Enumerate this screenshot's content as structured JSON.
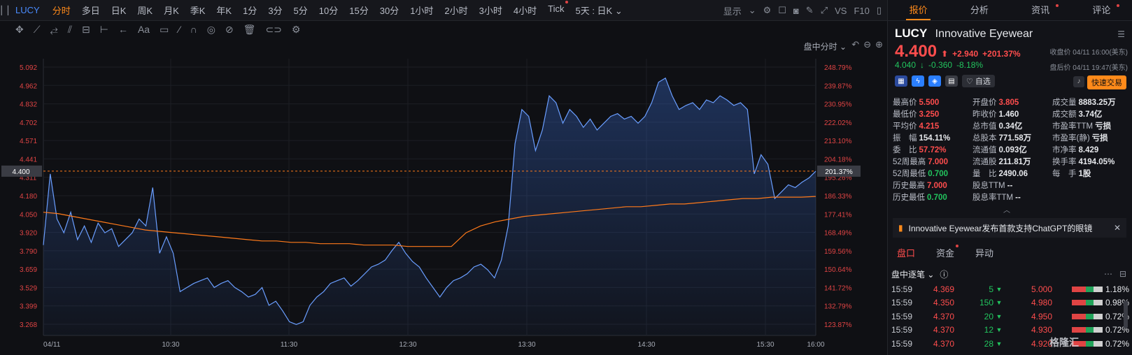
{
  "toolbar": {
    "symbol": "LUCY",
    "periods": [
      {
        "label": "分时",
        "active": true,
        "dot": false
      },
      {
        "label": "多日",
        "active": false,
        "dot": false
      },
      {
        "label": "日K",
        "active": false,
        "dot": false
      },
      {
        "label": "周K",
        "active": false,
        "dot": false
      },
      {
        "label": "月K",
        "active": false,
        "dot": false
      },
      {
        "label": "季K",
        "active": false,
        "dot": false
      },
      {
        "label": "年K",
        "active": false,
        "dot": false
      },
      {
        "label": "1分",
        "active": false,
        "dot": false
      },
      {
        "label": "3分",
        "active": false,
        "dot": false
      },
      {
        "label": "5分",
        "active": false,
        "dot": false
      },
      {
        "label": "10分",
        "active": false,
        "dot": false
      },
      {
        "label": "15分",
        "active": false,
        "dot": false
      },
      {
        "label": "30分",
        "active": false,
        "dot": false
      },
      {
        "label": "1小时",
        "active": false,
        "dot": false
      },
      {
        "label": "2小时",
        "active": false,
        "dot": false
      },
      {
        "label": "3小时",
        "active": false,
        "dot": false
      },
      {
        "label": "4小时",
        "active": false,
        "dot": false
      },
      {
        "label": "Tick",
        "active": false,
        "dot": true
      },
      {
        "label": "5天 : 日K ⌄",
        "active": false,
        "dot": false
      }
    ],
    "display_label": "显示",
    "vs_label": "VS",
    "f10_label": "F10"
  },
  "chart_mode_label": "盘中分时 ⌄",
  "chart_data": {
    "type": "line",
    "x_ticks": [
      "04/11",
      "10:30",
      "11:30",
      "12:30",
      "13:30",
      "14:30",
      "15:30",
      "16:00"
    ],
    "y_ticks_left": [
      "5.092",
      "4.962",
      "4.832",
      "4.702",
      "4.571",
      "4.441",
      "4.311",
      "4.180",
      "4.050",
      "3.920",
      "3.790",
      "3.659",
      "3.529",
      "3.399",
      "3.268"
    ],
    "y_ticks_right": [
      "248.79%",
      "239.87%",
      "230.95%",
      "222.02%",
      "213.10%",
      "204.18%",
      "195.26%",
      "186.33%",
      "177.41%",
      "168.49%",
      "159.56%",
      "150.64%",
      "141.72%",
      "132.79%",
      "123.87%"
    ],
    "ylim": [
      3.2,
      5.16
    ],
    "current_price": 4.4,
    "current_price_label": "4.400",
    "current_pct_label": "201.37%",
    "series": [
      {
        "values": [
          3.86,
          4.38,
          4.05,
          3.95,
          4.1,
          3.9,
          4.0,
          3.88,
          4.02,
          3.95,
          3.98,
          3.85,
          3.9,
          3.95,
          4.05,
          4.0,
          4.28,
          3.8,
          3.92,
          3.8,
          3.52,
          3.55,
          3.58,
          3.6,
          3.62,
          3.55,
          3.58,
          3.6,
          3.55,
          3.52,
          3.48,
          3.5,
          3.55,
          3.42,
          3.45,
          3.38,
          3.3,
          3.28,
          3.3,
          3.42,
          3.48,
          3.52,
          3.58,
          3.6,
          3.62,
          3.56,
          3.6,
          3.65,
          3.7,
          3.72,
          3.75,
          3.82,
          3.88,
          3.8,
          3.74,
          3.7,
          3.62,
          3.55,
          3.48,
          3.55,
          3.6,
          3.62,
          3.65,
          3.7,
          3.72,
          3.68,
          3.62,
          3.75,
          4.0,
          4.6,
          4.85,
          4.8,
          4.55,
          4.7,
          4.95,
          4.9,
          4.75,
          4.85,
          4.8,
          4.72,
          4.78,
          4.7,
          4.75,
          4.8,
          4.82,
          4.78,
          4.8,
          4.75,
          4.8,
          4.9,
          5.05,
          5.08,
          4.95,
          4.85,
          4.88,
          4.9,
          4.85,
          4.92,
          4.9,
          4.95,
          4.92,
          4.88,
          4.9,
          4.85,
          4.38,
          4.52,
          4.45,
          4.2,
          4.25,
          4.3,
          4.28,
          4.32,
          4.35,
          4.4
        ],
        "color": "#6a9eff"
      },
      {
        "values": [
          4.1,
          4.09,
          4.07,
          4.05,
          4.03,
          4.01,
          3.99,
          3.97,
          3.96,
          3.95,
          3.94,
          3.93,
          3.92,
          3.91,
          3.9,
          3.89,
          3.89,
          3.88,
          3.88,
          3.87,
          3.87,
          3.87,
          3.86,
          3.86,
          3.86,
          3.85,
          3.85,
          3.85,
          3.85,
          3.95,
          4.0,
          4.03,
          4.05,
          4.07,
          4.08,
          4.09,
          4.1,
          4.11,
          4.12,
          4.13,
          4.14,
          4.14,
          4.15,
          4.16,
          4.16,
          4.17,
          4.18,
          4.19,
          4.2,
          4.2,
          4.21,
          4.21,
          4.21,
          4.215
        ],
        "color": "#ff7a1a"
      }
    ]
  },
  "panel": {
    "tabs": [
      {
        "label": "报价",
        "active": true,
        "dot": false
      },
      {
        "label": "分析",
        "active": false,
        "dot": false
      },
      {
        "label": "资讯",
        "active": false,
        "dot": true
      },
      {
        "label": "评论",
        "active": false,
        "dot": true
      }
    ],
    "code": "LUCY",
    "name": "Innovative Eyewear",
    "price": "4.400",
    "arrow": "⬆",
    "change": "+2.940",
    "change_pct": "+201.37%",
    "close_time": "收盘价 04/11 16:00(美东)",
    "after_price": "4.040",
    "after_arrow": "↓",
    "after_change": "-0.360",
    "after_pct": "-8.18%",
    "after_time": "盘后价 04/11 19:47(美东)",
    "watch_label": "♡ 自选",
    "quick_trade": "快速交易"
  },
  "stats": [
    [
      {
        "label": "最高价",
        "value": "5.500",
        "cls": "red"
      },
      {
        "label": "开盘价",
        "value": "3.805",
        "cls": "red"
      },
      {
        "label": "成交量",
        "value": "8883.25万",
        "cls": ""
      }
    ],
    [
      {
        "label": "最低价",
        "value": "3.250",
        "cls": "red"
      },
      {
        "label": "昨收价",
        "value": "1.460",
        "cls": ""
      },
      {
        "label": "成交额",
        "value": "3.74亿",
        "cls": ""
      }
    ],
    [
      {
        "label": "平均价",
        "value": "4.215",
        "cls": "red"
      },
      {
        "label": "总市值",
        "value": "0.34亿",
        "cls": ""
      },
      {
        "label": "市盈率TTM",
        "value": "亏损",
        "cls": ""
      }
    ],
    [
      {
        "label": "振　幅",
        "value": "154.11%",
        "cls": ""
      },
      {
        "label": "总股本",
        "value": "771.58万",
        "cls": ""
      },
      {
        "label": "市盈率(静)",
        "value": "亏损",
        "cls": ""
      }
    ],
    [
      {
        "label": "委　比",
        "value": "57.72%",
        "cls": "red"
      },
      {
        "label": "流通值",
        "value": "0.093亿",
        "cls": ""
      },
      {
        "label": "市净率",
        "value": "8.429",
        "cls": ""
      }
    ],
    [
      {
        "label": "52周最高",
        "value": "7.000",
        "cls": "red"
      },
      {
        "label": "流通股",
        "value": "211.81万",
        "cls": ""
      },
      {
        "label": "换手率",
        "value": "4194.05%",
        "cls": ""
      }
    ],
    [
      {
        "label": "52周最低",
        "value": "0.700",
        "cls": "green"
      },
      {
        "label": "量　比",
        "value": "2490.06",
        "cls": ""
      },
      {
        "label": "每　手",
        "value": "1股",
        "cls": ""
      }
    ],
    [
      {
        "label": "历史最高",
        "value": "7.000",
        "cls": "red"
      },
      {
        "label": "股息TTM",
        "value": "--",
        "cls": ""
      },
      {
        "label": "",
        "value": "",
        "cls": ""
      }
    ],
    [
      {
        "label": "历史最低",
        "value": "0.700",
        "cls": "green"
      },
      {
        "label": "股息率TTM",
        "value": "--",
        "cls": ""
      },
      {
        "label": "",
        "value": "",
        "cls": ""
      }
    ]
  ],
  "news": {
    "text": "Innovative Eyewear发布首款支持ChatGPT的眼镜"
  },
  "sub_tabs": [
    {
      "label": "盘口",
      "active": true
    },
    {
      "label": "资金",
      "active": false,
      "dot": true
    },
    {
      "label": "异动",
      "active": false
    }
  ],
  "tick_header": "盘中逐笔 ⌄",
  "ticks": [
    {
      "time": "15:59",
      "price": "4.369",
      "vol": "5",
      "dir": "down"
    },
    {
      "time": "15:59",
      "price": "4.350",
      "vol": "150",
      "dir": "down"
    },
    {
      "time": "15:59",
      "price": "4.370",
      "vol": "20",
      "dir": "down"
    },
    {
      "time": "15:59",
      "price": "4.370",
      "vol": "12",
      "dir": "down"
    },
    {
      "time": "15:59",
      "price": "4.370",
      "vol": "28",
      "dir": "down"
    }
  ],
  "book": [
    {
      "price": "5.000",
      "pct": "1.18%"
    },
    {
      "price": "4.980",
      "pct": "0.98%"
    },
    {
      "price": "4.950",
      "pct": "0.72%"
    },
    {
      "price": "4.930",
      "pct": "0.72%"
    },
    {
      "price": "4.920",
      "pct": "0.72%"
    }
  ],
  "watermark": "格隆汇"
}
